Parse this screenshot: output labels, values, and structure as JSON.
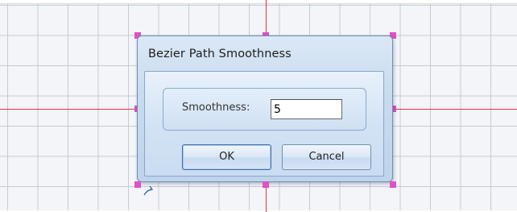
{
  "dialog": {
    "title": "Bezier Path Smoothness",
    "field_label": "Smoothness:",
    "field_value": "5",
    "ok_label": "OK",
    "cancel_label": "Cancel"
  },
  "colors": {
    "axis": "#e8323a",
    "handle": "#e24fc4",
    "grid_line": "#c7cbd2",
    "dialog_border": "#6e8fb3"
  },
  "icons": {
    "handle": "selection-handle-icon",
    "rotate": "rotate-cursor-icon"
  }
}
